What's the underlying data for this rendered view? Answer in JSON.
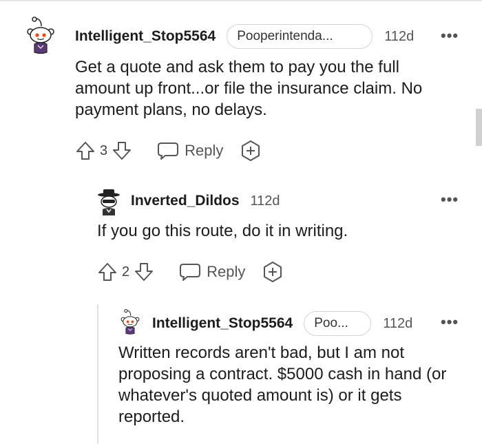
{
  "comments": [
    {
      "username": "Intelligent_Stop5564",
      "flair": "Pooperintenda...",
      "age": "112d",
      "text": "Get a quote and ask them to pay you the full amount up front...or file the insurance claim. No payment plans, no delays.",
      "score": "3",
      "reply_label": "Reply",
      "avatar": "snoo-avatar-icon"
    },
    {
      "username": "Inverted_Dildos",
      "age": "112d",
      "text": "If you go this route, do it in writing.",
      "score": "2",
      "reply_label": "Reply",
      "avatar": "snoo-detective-avatar-icon"
    },
    {
      "username": "Intelligent_Stop5564",
      "flair": "Poo...",
      "age": "112d",
      "text": "Written records aren't bad, but I am not proposing a contract. $5000 cash in hand (or whatever's quoted amount is) or it gets reported.",
      "avatar": "snoo-avatar-icon"
    }
  ],
  "more_glyph": "•••",
  "colors": {
    "text": "#1c1c1c",
    "muted": "#555555",
    "border": "#d4d4d4",
    "snoo_orange": "#ff4500",
    "outfit_purple": "#5b3a7a"
  }
}
